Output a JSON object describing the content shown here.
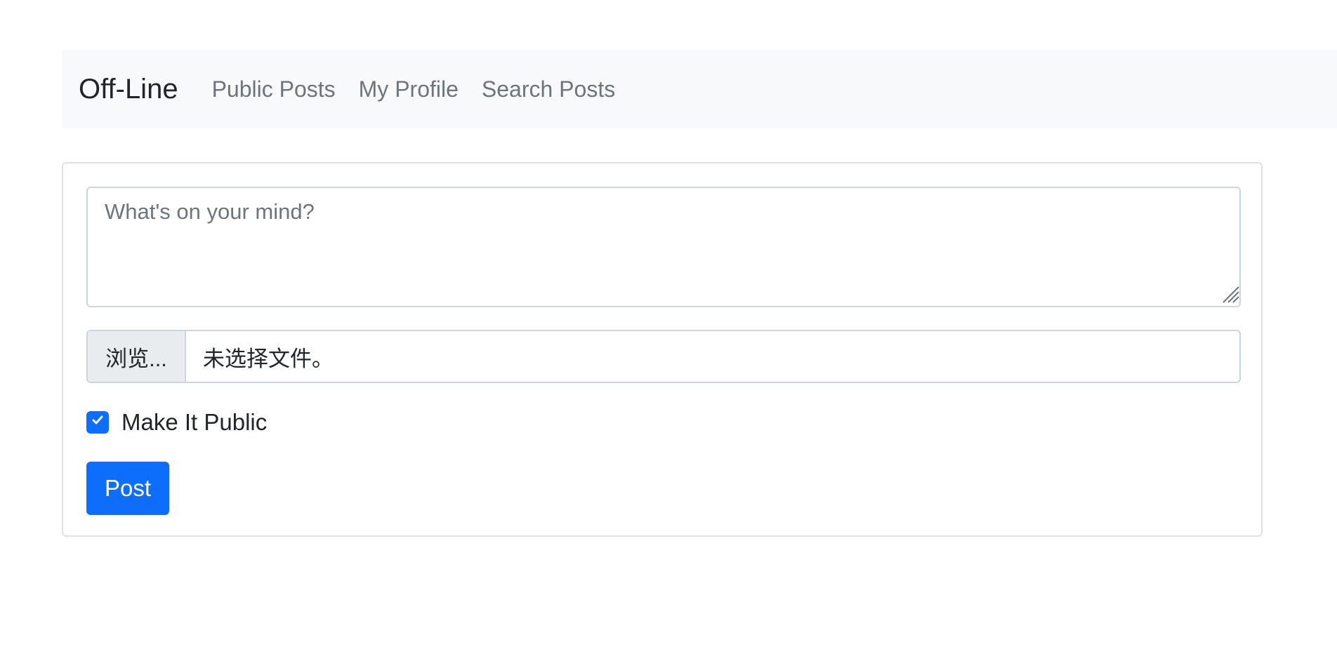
{
  "navbar": {
    "brand": "Off-Line",
    "links": [
      "Public Posts",
      "My Profile",
      "Search Posts"
    ]
  },
  "post_form": {
    "textarea_value": "",
    "textarea_placeholder": "What's on your mind?",
    "file_browse_label": "浏览...",
    "file_name": "未选择文件。",
    "public_checkbox_label": "Make It Public",
    "public_checked": true,
    "submit_label": "Post"
  },
  "icons": {
    "checkbox": "check-icon",
    "textarea_grip": "resize-grip-icon"
  },
  "colors": {
    "primary": "#0d6efd",
    "navbar_bg": "#f8f9fa",
    "nav_link": "#6c757d",
    "text": "#212529",
    "border": "#ced4da"
  }
}
